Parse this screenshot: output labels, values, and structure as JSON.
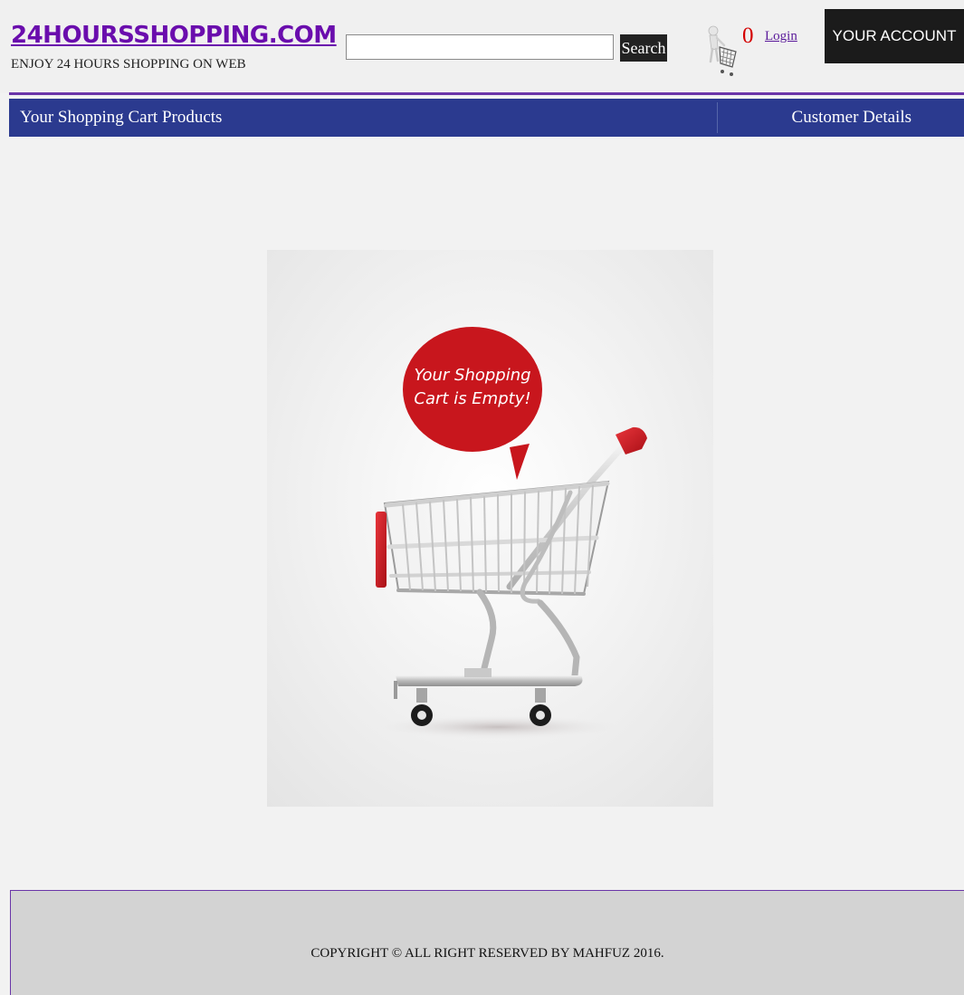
{
  "header": {
    "logo_text": "24HOURSSHOPPING.COM",
    "tagline": "ENJOY 24 HOURS SHOPPING ON WEB",
    "search": {
      "value": "",
      "placeholder": "",
      "button_label": "Search"
    },
    "cart_count": "0",
    "login_label": "Login",
    "account_label": "YOUR ACCOUNT"
  },
  "nav": {
    "cart_products_label": "Your Shopping Cart Products",
    "customer_details_label": "Customer Details"
  },
  "main": {
    "empty_message_line1": "Your Shopping",
    "empty_message_line2": "Cart is Empty!"
  },
  "footer": {
    "copyright": "COPYRIGHT © ALL RIGHT RESERVED BY MAHFUZ 2016."
  },
  "colors": {
    "brand_purple": "#6a0dad",
    "nav_blue": "#2b3a8f",
    "cart_red": "#c8161d",
    "account_black": "#1b1b1b",
    "footer_gray": "#d3d3d3"
  },
  "icons": {
    "cart_thumbnail": "shopping-cart-person-icon",
    "empty_cart": "empty-shopping-cart-illustration"
  }
}
